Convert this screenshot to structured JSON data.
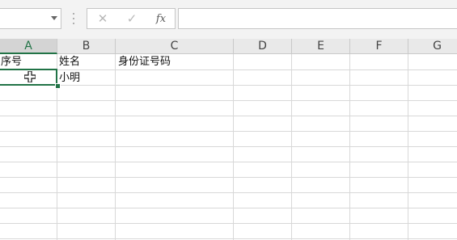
{
  "formula_bar": {
    "name_box_value": "",
    "cancel_icon": "cancel-x-icon",
    "enter_icon": "checkmark-icon",
    "function_label": "fx",
    "formula_value": ""
  },
  "columns": [
    "A",
    "B",
    "C",
    "D",
    "E",
    "F",
    "G"
  ],
  "active_column": "A",
  "rows": [
    [
      "序号",
      "姓名",
      "身份证号码",
      "",
      "",
      "",
      ""
    ],
    [
      "",
      "小明",
      "",
      "",
      "",
      "",
      ""
    ]
  ],
  "selected_cell": "A2",
  "colors": {
    "accent": "#217346",
    "header_bg": "#e9e9e9",
    "gridline": "#d8d8d8"
  }
}
